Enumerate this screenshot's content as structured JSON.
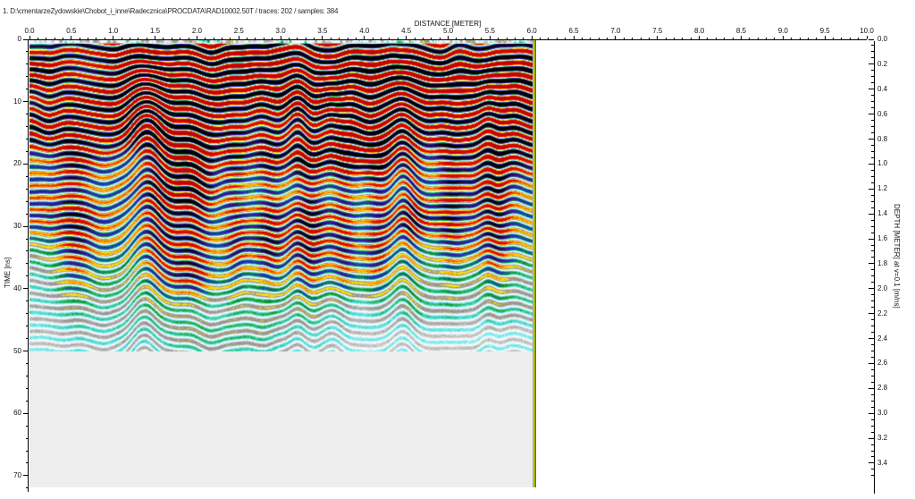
{
  "header": {
    "title": "1. D:\\cmentarzeZydowskie\\Chobot_i_inne\\Radecznica\\PROCDATA\\RAD10002.50T / traces: 202 / samples: 384"
  },
  "axes": {
    "distance": {
      "title": "DISTANCE [METER]",
      "ticks": [
        "0.0",
        "0.5",
        "1.0",
        "1.5",
        "2.0",
        "2.5",
        "3.0",
        "3.5",
        "4.0",
        "4.5",
        "5.0",
        "5.5",
        "6.0",
        "6.5",
        "7.0",
        "7.5",
        "8.0",
        "8.5",
        "9.0",
        "9.5",
        "10.0"
      ],
      "minor_step": 0.1
    },
    "time": {
      "title": "TIME [ns]",
      "ticks": [
        "0",
        "10",
        "20",
        "30",
        "40",
        "50",
        "60",
        "70"
      ],
      "minor_step": 2
    },
    "depth": {
      "title": "DEPTH [METER] at v=0.1 [m/ns]",
      "ticks": [
        "0.0",
        "0.2",
        "0.4",
        "0.6",
        "0.8",
        "1.0",
        "1.2",
        "1.4",
        "1.6",
        "1.8",
        "2.0",
        "2.2",
        "2.4",
        "2.6",
        "2.8",
        "3.0",
        "3.2",
        "3.4"
      ],
      "minor_step": 0.05
    }
  },
  "colormap": {
    "positive": [
      [
        0,
        "#ffffff"
      ],
      [
        0.1,
        "#e6e6e6"
      ],
      [
        0.3,
        "#8c8c8c"
      ],
      [
        0.38,
        "#ffee00"
      ],
      [
        0.48,
        "#ff9600"
      ],
      [
        0.62,
        "#e10a05"
      ],
      [
        1,
        "#c00500"
      ]
    ],
    "negative": [
      [
        0,
        "#ffffff"
      ],
      [
        0.1,
        "#d8f6f6"
      ],
      [
        0.22,
        "#5ae1e6"
      ],
      [
        0.34,
        "#19a01e"
      ],
      [
        0.46,
        "#193cc8"
      ],
      [
        0.6,
        "#460f8c"
      ],
      [
        0.78,
        "#060408"
      ],
      [
        1,
        "#000000"
      ]
    ],
    "no_data_region": "#ededed",
    "profile_end_marker": "#aab000"
  },
  "chart_data": {
    "type": "heatmap",
    "title": "GPR radargram (amplitude section)",
    "xlabel": "DISTANCE [METER]",
    "ylabel_left": "TIME [ns]",
    "ylabel_right": "DEPTH [METER] at v=0.1 [m/ns]",
    "x_range": [
      0.0,
      10.0
    ],
    "time_range_ns": [
      0,
      72
    ],
    "depth_range_m": [
      0.0,
      3.5
    ],
    "velocity_m_per_ns": 0.1,
    "traces": 202,
    "samples": 384,
    "data_extent": {
      "distance_m": [
        0.0,
        6.0
      ],
      "time_ns": [
        0,
        50
      ]
    },
    "grid": false,
    "legend": "none",
    "zones": [
      {
        "time_ns": [
          0,
          15
        ],
        "character": "very strong continuous horizontal reflections; alternating red (positive) and black (negative) wavy bands with yellow/purple fringes"
      },
      {
        "time_ns": [
          15,
          33
        ],
        "character": "medium-strong reflections with vertical ringing columns (red/yellow peaks, purple/black troughs) separated by weaker green/cyan/white zones"
      },
      {
        "time_ns": [
          33,
          50
        ],
        "character": "weak reflections; white/gray background with soft cyan and green wiggles, occasional blue spots"
      },
      {
        "time_ns": [
          50,
          72
        ],
        "character": "no data: uniform light gray fill below 50 ns within 0-6 m"
      }
    ],
    "features": [
      {
        "distance_m": 1.4,
        "note": "sag/dip of strong shallow banding"
      },
      {
        "distance_m": [
          1.7,
          2.3
        ],
        "note": "strong ringing columns reaching ~35 ns"
      },
      {
        "distance_m": 6.0,
        "note": "yellow-olive vertical end-of-profile marker line"
      }
    ]
  }
}
